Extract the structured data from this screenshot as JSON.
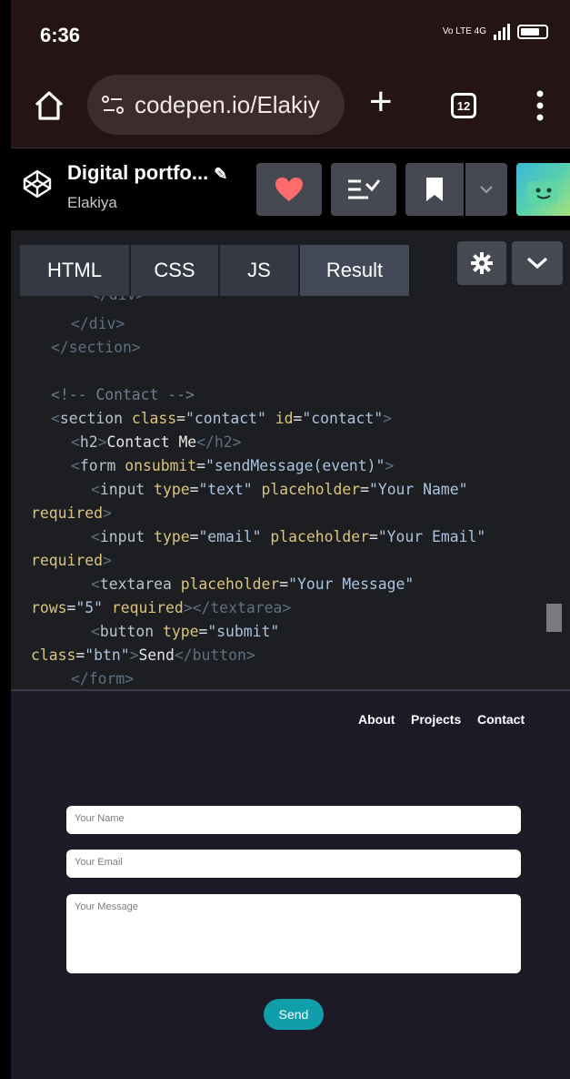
{
  "status": {
    "time": "6:36",
    "network": "Vo LTE 4G"
  },
  "browser": {
    "url": "codepen.io/Elakiy",
    "tab_count": "12"
  },
  "pen": {
    "title": "Digital portfo...",
    "author": "Elakiya"
  },
  "editor_tabs": [
    "HTML",
    "CSS",
    "JS",
    "Result"
  ],
  "code": {
    "l1": "</div>",
    "l2": "</section>",
    "l3": "<!-- Contact -->",
    "l4": [
      "<",
      "section",
      " class",
      "=",
      "\"contact\"",
      " id",
      "=",
      "\"contact\"",
      ">"
    ],
    "l5_open": "<",
    "l5_tag": "h2",
    "l5_close": ">",
    "l5_text": "Contact Me",
    "l5_end": "</h2>",
    "l6": [
      "<",
      "form",
      " onsubmit",
      "=",
      "\"sendMessage(event)\"",
      ">"
    ],
    "l7": [
      "<",
      "input",
      " type",
      "=",
      "\"text\"",
      " placeholder",
      "=",
      "\"Your Name\""
    ],
    "l8": [
      "required",
      ">"
    ],
    "l9": [
      "<",
      "input",
      " type",
      "=",
      "\"email\"",
      " placeholder",
      "=",
      "\"Your Email\""
    ],
    "l10": [
      "required",
      ">"
    ],
    "l11": [
      "<",
      "textarea",
      " placeholder",
      "=",
      "\"Your Message\""
    ],
    "l12": [
      "rows",
      "=",
      "\"5\"",
      " required",
      ">",
      "</textarea>"
    ],
    "l13": [
      "<",
      "button",
      " type",
      "=",
      "\"submit\""
    ],
    "l14": [
      "class",
      "=",
      "\"btn\"",
      ">",
      "Send",
      "</button>"
    ],
    "l15": "</form>"
  },
  "result": {
    "nav": [
      "About",
      "Projects",
      "Contact"
    ],
    "form": {
      "name_placeholder": "Your Name",
      "email_placeholder": "Your Email",
      "message_placeholder": "Your Message",
      "send_label": "Send"
    }
  },
  "colors": {
    "accent_send": "#0f9eaa",
    "heart": "#ff6b6b",
    "status_bg": "#241414"
  }
}
